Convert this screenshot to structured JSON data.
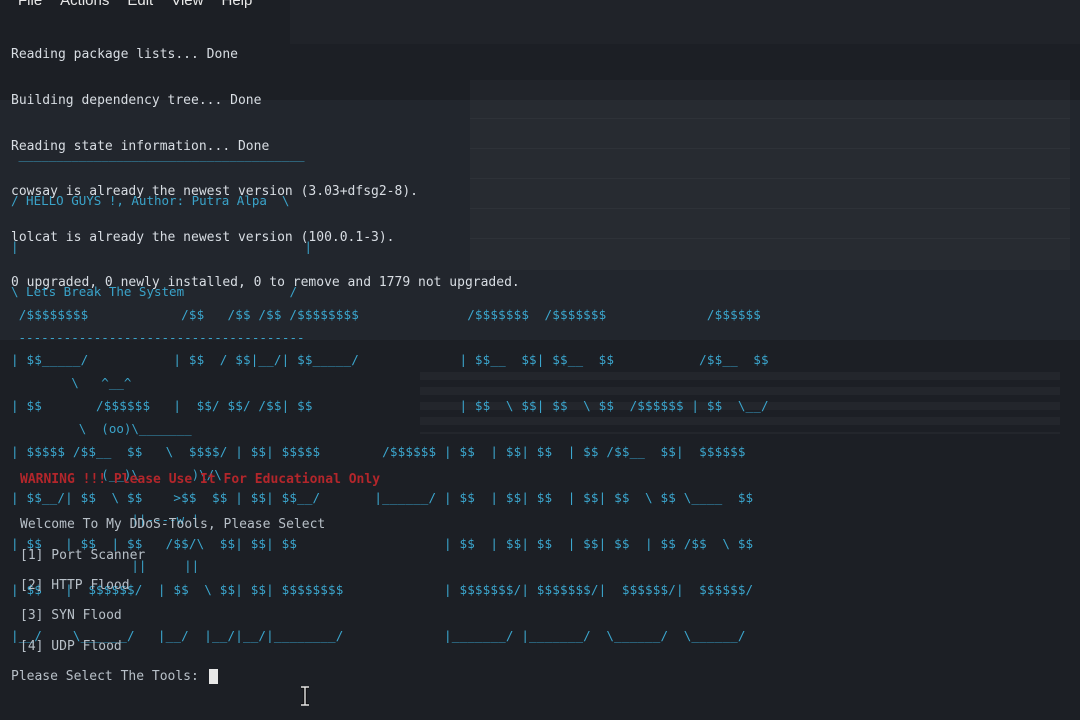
{
  "menubar": {
    "items": [
      "File",
      "Actions",
      "Edit",
      "View",
      "Help"
    ]
  },
  "apt_output": [
    "Reading package lists... Done",
    "Building dependency tree... Done",
    "Reading state information... Done",
    "cowsay is already the newest version (3.03+dfsg2-8).",
    "lolcat is already the newest version (100.0.1-3).",
    "0 upgraded, 0 newly installed, 0 to remove and 1779 not upgraded."
  ],
  "cowsay": {
    "lines": [
      " ______________________________________",
      "/ HELLO GUYS !, Author: Putra Alpa  \\",
      "|                                      |",
      "\\ Lets Break The System              /",
      " --------------------------------------",
      "        \\   ^__^",
      "         \\  (oo)\\_______",
      "            (__)\\       )\\/\\",
      "                ||----w |",
      "                ||     ||"
    ]
  },
  "banner": {
    "lines": [
      " /$$$$$$$$            /$$   /$$ /$$ /$$$$$$$$              /$$$$$$$  /$$$$$$$             /$$$$$$ ",
      "| $$_____/           | $$  / $$|__/| $$_____/             | $$__  $$| $$__  $$           /$$__  $$",
      "| $$       /$$$$$$   |  $$/ $$/ /$$| $$                   | $$  \\ $$| $$  \\ $$  /$$$$$$ | $$  \\__/",
      "| $$$$$ /$$__  $$   \\  $$$$/ | $$| $$$$$        /$$$$$$ | $$  | $$| $$  | $$ /$$__  $$|  $$$$$$ ",
      "| $$__/| $$  \\ $$    >$$  $$ | $$| $$__/       |______/ | $$  | $$| $$  | $$| $$  \\ $$ \\____  $$",
      "| $$   | $$  | $$   /$$/\\  $$| $$| $$                   | $$  | $$| $$  | $$| $$  | $$ /$$  \\ $$",
      "| $$   |  $$$$$$/  | $$  \\ $$| $$| $$$$$$$$             | $$$$$$$/| $$$$$$$/|  $$$$$$/|  $$$$$$/",
      "|__/    \\______/   |__/  |__/|__/|________/             |_______/ |_______/  \\______/  \\______/ "
    ]
  },
  "warning": "WARNING !!! Please Use It For Educational Only",
  "welcome": "Welcome To My DDoS-Tools, Please Select",
  "options": [
    "[1] Port Scanner",
    "[2] HTTP Flood",
    "[3] SYN Flood",
    "[4] UDP Flood"
  ],
  "prompt": "Please Select The Tools: ",
  "colors": {
    "background": "#1c1f25",
    "text": "#d8dde3",
    "banner": "#3ba7cf",
    "warning": "#b3262b"
  }
}
